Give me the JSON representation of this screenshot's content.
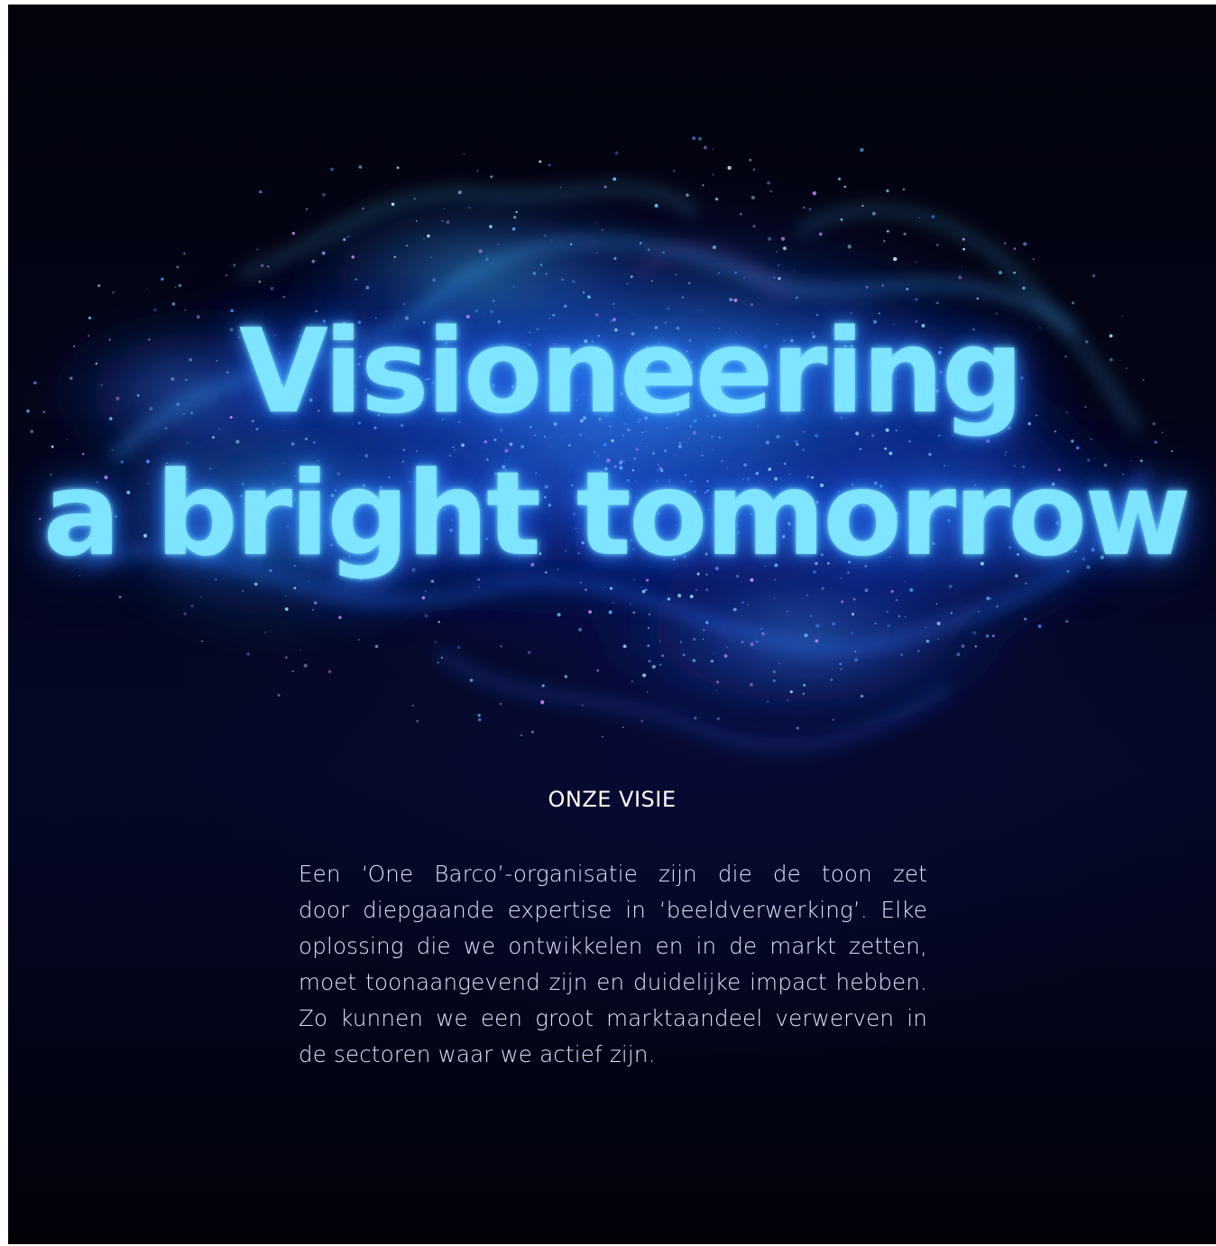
{
  "hero": {
    "headline_line1": "Visioneering",
    "headline_line2": "a bright tomorrow",
    "colors": {
      "background": "#02030c",
      "glow": "#7fe4ff",
      "particles": "#2a6cff"
    }
  },
  "section": {
    "label": "ONZE VISIE"
  },
  "body": {
    "lines": [
      "Een ‘One Barco’-organisatie zijn die de toon zet",
      "door diepgaande expertise in ‘beeldverwerking’. Elke",
      "oplossing die we ontwikkelen en in de markt zetten,",
      "moet toonaangevend zijn en duidelijke impact hebben.",
      "Zo kunnen we een groot marktaandeel verwerven in",
      "de sectoren waar we actief zijn."
    ]
  }
}
